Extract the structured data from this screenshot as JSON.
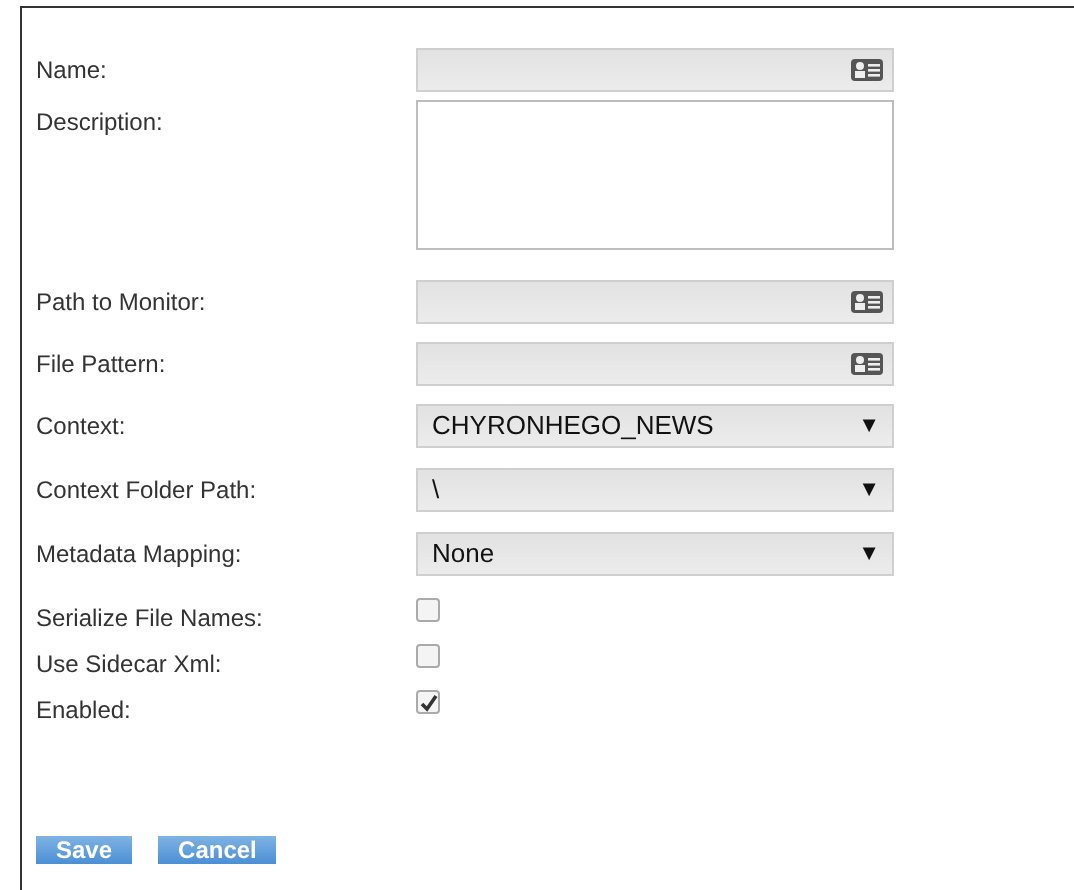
{
  "fields": [
    {
      "kind": "text",
      "label": "Name:"
    },
    {
      "kind": "textarea",
      "label": "Description:"
    },
    {
      "kind": "text",
      "label": "Path to Monitor:"
    },
    {
      "kind": "text",
      "label": "File Pattern:"
    },
    {
      "kind": "select",
      "label": "Context:",
      "value": "CHYRONHEGO_NEWS",
      "arrow": "▼"
    },
    {
      "kind": "select",
      "label": "Context Folder Path:",
      "value": "\\",
      "arrow": "▼"
    },
    {
      "kind": "select",
      "label": "Metadata Mapping:",
      "value": "None",
      "arrow": "▼"
    },
    {
      "kind": "checkbox",
      "label": "Serialize File Names:",
      "checked": false
    },
    {
      "kind": "checkbox",
      "label": "Use Sidecar Xml:",
      "checked": false
    },
    {
      "kind": "checkbox",
      "label": "Enabled:",
      "checked": true
    }
  ],
  "buttons": [
    "Save",
    "Cancel"
  ]
}
